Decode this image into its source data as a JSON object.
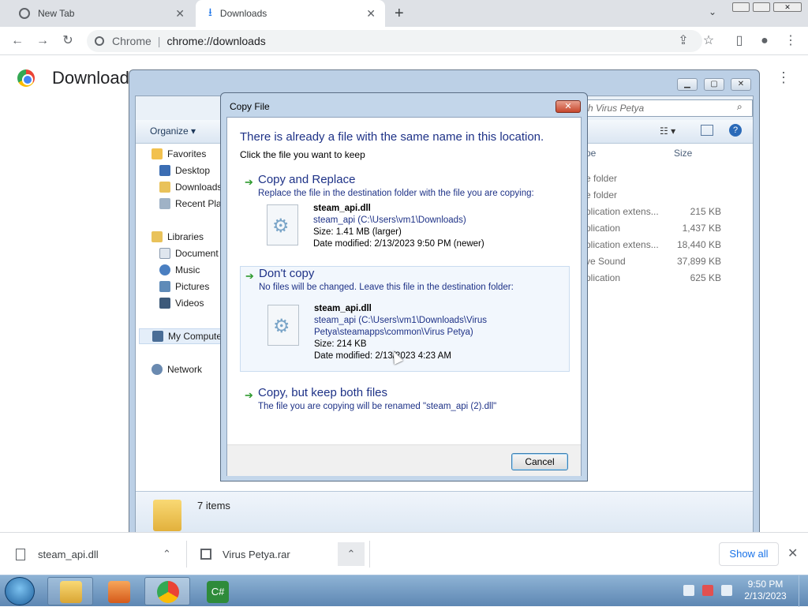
{
  "browser": {
    "tabs": [
      {
        "label": "New Tab",
        "icon": "chrome-tab-icon"
      },
      {
        "label": "Downloads",
        "icon": "download-icon"
      }
    ],
    "new_tab_symbol": "+",
    "omnibox": {
      "site": "Chrome",
      "url": "chrome://downloads"
    },
    "page_title": "Downloads"
  },
  "explorer": {
    "organize_label": "Organize ▾",
    "search_placeholder": "ch Virus Petya",
    "nav": {
      "favorites": "Favorites",
      "desktop": "Desktop",
      "downloads": "Downloads",
      "recent": "Recent Plac",
      "libraries": "Libraries",
      "documents": "Document",
      "music": "Music",
      "pictures": "Pictures",
      "videos": "Videos",
      "computer": "My Compute",
      "network": "Network"
    },
    "columns": {
      "type": "pe",
      "size": "Size"
    },
    "rows": [
      {
        "type": "e folder",
        "size": ""
      },
      {
        "type": "e folder",
        "size": ""
      },
      {
        "type": "plication extens...",
        "size": "215 KB"
      },
      {
        "type": "plication",
        "size": "1,437 KB"
      },
      {
        "type": "plication extens...",
        "size": "18,440 KB"
      },
      {
        "type": "ve Sound",
        "size": "37,899 KB"
      },
      {
        "type": "plication",
        "size": "625 KB"
      }
    ],
    "items_count": "7 items",
    "breadcrumb_chevrons": "«"
  },
  "dialog": {
    "title": "Copy File",
    "close_label": "✕",
    "heading": "There is already a file with the same name in this location.",
    "subheading": "Click the file you want to keep",
    "options": [
      {
        "title": "Copy and Replace",
        "desc": "Replace the file in the destination folder with the file you are copying:",
        "file_name": "steam_api.dll",
        "path": "steam_api (C:\\Users\\vm1\\Downloads)",
        "path2": "",
        "size": "Size: 1.41 MB (larger)",
        "modified": "Date modified: 2/13/2023 9:50 PM (newer)"
      },
      {
        "title": "Don't copy",
        "desc": "No files will be changed. Leave this file in the destination folder:",
        "file_name": "steam_api.dll",
        "path": "steam_api (C:\\Users\\vm1\\Downloads\\Virus",
        "path2": "Petya\\steamapps\\common\\Virus Petya)",
        "size": "Size: 214 KB",
        "modified": "Date modified: 2/13/2023 4:23 AM"
      },
      {
        "title": "Copy, but keep both files",
        "desc": "The file you are copying will be renamed \"steam_api (2).dll\""
      }
    ],
    "cancel_label": "Cancel"
  },
  "download_bar": {
    "items": [
      {
        "name": "steam_api.dll"
      },
      {
        "name": "Virus Petya.rar"
      }
    ],
    "show_all": "Show all"
  },
  "taskbar": {
    "clock_time": "9:50 PM",
    "clock_date": "2/13/2023"
  }
}
